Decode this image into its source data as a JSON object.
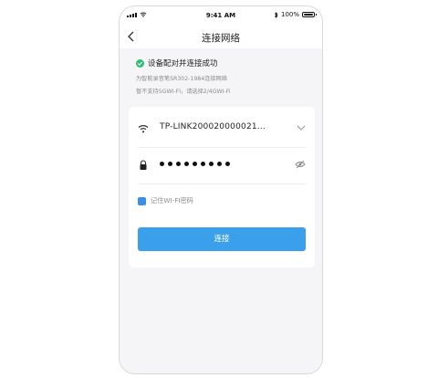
{
  "status_bar": {
    "time": "9:41 AM",
    "battery": "100%"
  },
  "nav": {
    "title": "连接网络"
  },
  "success": {
    "text": "设备配对并连接成功",
    "color": "#2fbf71"
  },
  "hints": [
    "为智能录音笔SR302-1984连接网络",
    "暂不支持5GWI-FI，请选择2/4GWI-Fi"
  ],
  "form": {
    "ssid": "TP-LINK200020000021...",
    "password_mask": "•••••••••",
    "remember_label": "记住WI-FI密码",
    "remember_checked": true,
    "connect_label": "连接"
  },
  "icons": {
    "back": "back-arrow-icon",
    "wifi": "wifi-icon",
    "dropdown": "chevron-down-icon",
    "lock": "lock-icon",
    "eye": "eye-hidden-icon",
    "check": "check-circle-icon"
  },
  "colors": {
    "accent": "#3aa0ec",
    "checkbox": "#3a8ee6"
  }
}
